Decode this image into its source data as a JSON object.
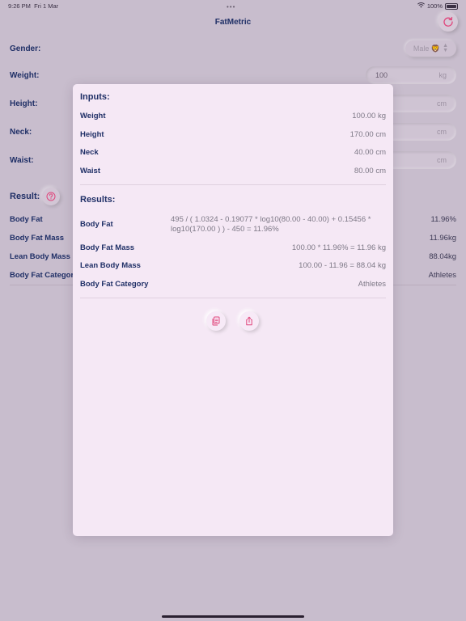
{
  "status": {
    "time": "9:26 PM",
    "date": "Fri 1 Mar",
    "battery": "100%"
  },
  "app": {
    "title": "FatMetric"
  },
  "form": {
    "gender": {
      "label": "Gender:",
      "value": "Male 🦁"
    },
    "weight": {
      "label": "Weight:",
      "value": "100",
      "unit": "kg"
    },
    "height": {
      "label": "Height:",
      "unit": "cm"
    },
    "neck": {
      "label": "Neck:",
      "unit": "cm"
    },
    "waist": {
      "label": "Waist:",
      "unit": "cm"
    }
  },
  "background_results": {
    "heading": "Result:",
    "rows": [
      {
        "label": "Body Fat",
        "value": "11.96%"
      },
      {
        "label": "Body Fat Mass",
        "value": "11.96kg"
      },
      {
        "label": "Lean Body Mass",
        "value": "88.04kg"
      },
      {
        "label": "Body Fat Category",
        "value": "Athletes"
      }
    ]
  },
  "modal": {
    "inputs_heading": "Inputs:",
    "inputs": [
      {
        "label": "Weight",
        "value": "100.00 kg"
      },
      {
        "label": "Height",
        "value": "170.00 cm"
      },
      {
        "label": "Neck",
        "value": "40.00 cm"
      },
      {
        "label": "Waist",
        "value": "80.00 cm"
      }
    ],
    "results_heading": "Results:",
    "results": [
      {
        "label": "Body Fat",
        "value": "495 / ( 1.0324 - 0.19077 * log10(80.00 - 40.00) + 0.15456 * log10(170.00 ) ) - 450 = 11.96%"
      },
      {
        "label": "Body Fat Mass",
        "value": "100.00 * 11.96% = 11.96 kg"
      },
      {
        "label": "Lean Body Mass",
        "value": "100.00 - 11.96 = 88.04 kg"
      },
      {
        "label": "Body Fat Category",
        "value": "Athletes"
      }
    ]
  },
  "icons": {
    "refresh": "refresh-icon",
    "help": "question-circle-icon",
    "copy": "copy-icon",
    "share": "share-icon"
  },
  "colors": {
    "accent": "#e0457b",
    "text": "#1f2f66",
    "modal_bg": "#f5e8f5",
    "backdrop": "#c8bdcd"
  }
}
